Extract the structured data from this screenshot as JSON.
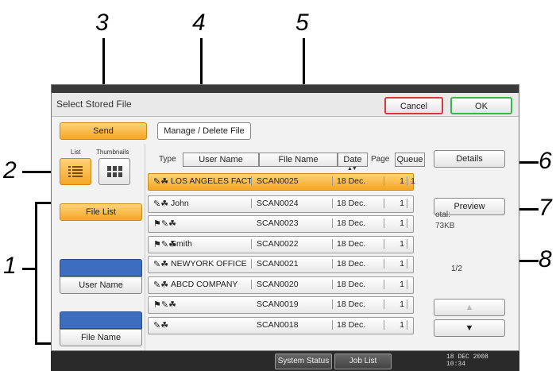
{
  "callouts": [
    "3",
    "4",
    "5",
    "2",
    "6",
    "7",
    "1",
    "8"
  ],
  "window": {
    "title": "Select Stored File",
    "cancel": "Cancel",
    "ok": "OK"
  },
  "tabs": {
    "send": "Send",
    "manage": "Manage / Delete File"
  },
  "view": {
    "list_label": "List",
    "thumbnails_label": "Thumbnails"
  },
  "sidebar": {
    "file_list": "File List",
    "user_name": "User Name",
    "file_name": "File Name"
  },
  "columns": {
    "type": "Type",
    "user_name": "User Name",
    "file_name": "File Name",
    "date": "Date",
    "page": "Page",
    "queue": "Queue"
  },
  "rows": [
    {
      "icons": "✎☘",
      "user": "LOS ANGELES FACT",
      "file": "SCAN0025",
      "date": "18 Dec.",
      "page": "1",
      "queue": "1",
      "selected": true
    },
    {
      "icons": "✎☘",
      "user": "John",
      "file": "SCAN0024",
      "date": "18 Dec.",
      "page": "1",
      "queue": "",
      "selected": false
    },
    {
      "icons": "⚑✎☘",
      "user": "",
      "file": "SCAN0023",
      "date": "18 Dec.",
      "page": "1",
      "queue": "",
      "selected": false
    },
    {
      "icons": "⚑✎☘",
      "user": "Smith",
      "file": "SCAN0022",
      "date": "18 Dec.",
      "page": "1",
      "queue": "",
      "selected": false
    },
    {
      "icons": "✎☘",
      "user": "NEWYORK OFFICE",
      "file": "SCAN0021",
      "date": "18 Dec.",
      "page": "1",
      "queue": "",
      "selected": false
    },
    {
      "icons": "✎☘",
      "user": "ABCD COMPANY",
      "file": "SCAN0020",
      "date": "18 Dec.",
      "page": "1",
      "queue": "",
      "selected": false
    },
    {
      "icons": "⚑✎☘",
      "user": "",
      "file": "SCAN0019",
      "date": "18 Dec.",
      "page": "1",
      "queue": "",
      "selected": false
    },
    {
      "icons": "✎☘",
      "user": "",
      "file": "SCAN0018",
      "date": "18 Dec.",
      "page": "1",
      "queue": "",
      "selected": false
    }
  ],
  "right_panel": {
    "details": "Details",
    "preview": "Preview",
    "total_label": "otal:",
    "total_value": "73KB",
    "page_indicator": "1/2",
    "up": "▲",
    "down": "▼"
  },
  "bottom": {
    "system_status": "System Status",
    "job_list": "Job List",
    "date": "18 DEC  2008",
    "time": "10:34"
  }
}
